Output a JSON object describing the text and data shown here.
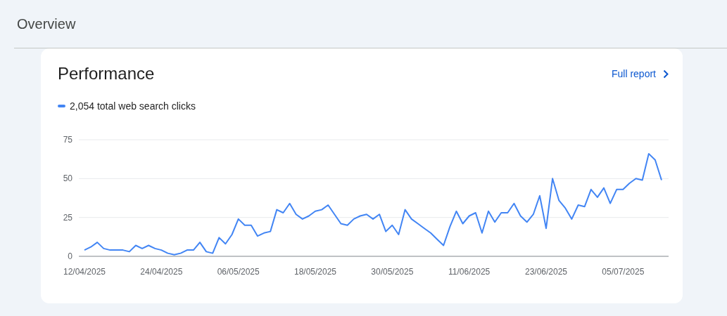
{
  "header": {
    "title": "Overview"
  },
  "card": {
    "title": "Performance",
    "link": "Full report",
    "legend": "2,054 total web search clicks",
    "chart_data": {
      "type": "line",
      "categories": [
        "12/04/2025",
        null,
        null,
        null,
        null,
        null,
        null,
        null,
        null,
        null,
        null,
        null,
        "24/04/2025",
        null,
        null,
        null,
        null,
        null,
        null,
        null,
        null,
        null,
        null,
        null,
        "06/05/2025",
        null,
        null,
        null,
        null,
        null,
        null,
        null,
        null,
        null,
        null,
        null,
        "18/05/2025",
        null,
        null,
        null,
        null,
        null,
        null,
        null,
        null,
        null,
        null,
        null,
        "30/05/2025",
        null,
        null,
        null,
        null,
        null,
        null,
        null,
        null,
        null,
        null,
        null,
        "11/06/2025",
        null,
        null,
        null,
        null,
        null,
        null,
        null,
        null,
        null,
        null,
        null,
        "23/06/2025",
        null,
        null,
        null,
        null,
        null,
        null,
        null,
        null,
        null,
        null,
        null,
        "05/07/2025",
        null,
        null,
        null,
        null,
        null,
        null
      ],
      "series": [
        {
          "color": "#4285f4",
          "values": [
            4,
            6,
            9,
            5,
            4,
            4,
            4,
            3,
            7,
            5,
            7,
            5,
            4,
            2,
            1,
            2,
            4,
            4,
            9,
            3,
            2,
            12,
            8,
            14,
            24,
            20,
            20,
            13,
            15,
            16,
            30,
            28,
            34,
            27,
            24,
            26,
            29,
            30,
            33,
            27,
            21,
            20,
            24,
            26,
            27,
            24,
            27,
            16,
            20,
            14,
            30,
            24,
            21,
            18,
            15,
            11,
            7,
            19,
            29,
            21,
            26,
            28,
            15,
            29,
            22,
            28,
            28,
            34,
            26,
            22,
            27,
            39,
            18,
            50,
            36,
            31,
            24,
            33,
            32,
            43,
            38,
            44,
            34,
            43,
            43,
            47,
            50,
            49,
            66,
            62,
            49
          ]
        }
      ],
      "ylim": [
        0,
        75
      ],
      "yticks": [
        0,
        25,
        50,
        75
      ]
    }
  }
}
